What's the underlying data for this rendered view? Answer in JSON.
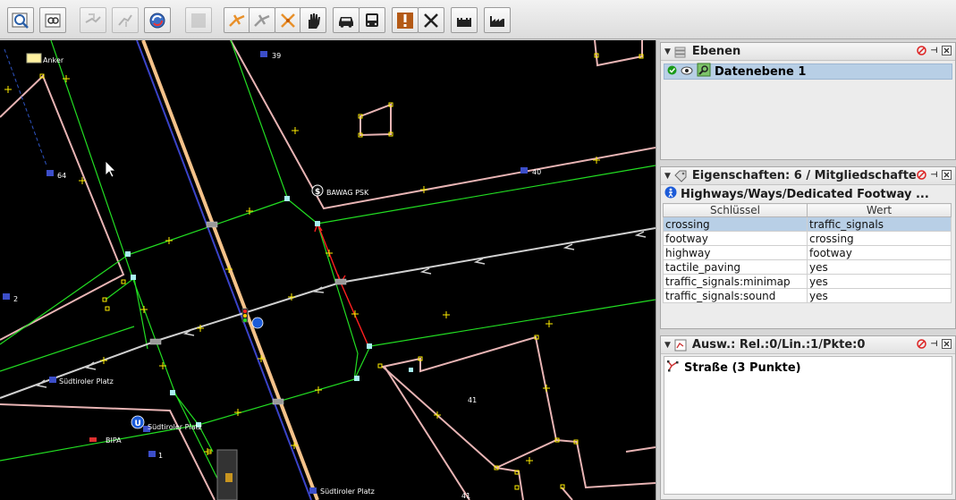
{
  "toolbar": {
    "buttons": [
      {
        "icon": "zoom-to-data-icon",
        "enabled": true
      },
      {
        "icon": "zoom-to-selection-icon",
        "enabled": true
      },
      {
        "icon": "download-icon",
        "enabled": false
      },
      {
        "icon": "upload-icon",
        "enabled": false
      },
      {
        "icon": "refresh-icon",
        "enabled": true
      },
      {
        "icon": "empty-icon",
        "enabled": false
      },
      {
        "icon": "highway-tool-icon",
        "enabled": true
      },
      {
        "icon": "highway-tool-disabled-icon",
        "enabled": false
      },
      {
        "icon": "cross-tool-icon",
        "enabled": true
      },
      {
        "icon": "hand-icon",
        "enabled": true
      },
      {
        "icon": "car-icon",
        "enabled": true
      },
      {
        "icon": "bus-icon",
        "enabled": true
      },
      {
        "icon": "warning-icon",
        "enabled": true
      },
      {
        "icon": "restaurant-icon",
        "enabled": true
      },
      {
        "icon": "castle-icon",
        "enabled": true
      },
      {
        "icon": "industry-icon",
        "enabled": true
      }
    ]
  },
  "map": {
    "labels": {
      "anker": "Anker",
      "bawag": "BAWAG PSK",
      "suedtiroler_1": "Südtiroler Platz",
      "suedtiroler_2": "Südtiroler Platz",
      "suedtiroler_3": "Südtiroler Platz",
      "bipa": "BIPA",
      "n39": "39",
      "n40": "40",
      "n64": "64",
      "n2": "2",
      "n1": "1",
      "n41a": "41",
      "n41b": "41"
    }
  },
  "layers_panel": {
    "title": "Ebenen",
    "layers": [
      {
        "name": "Datenebene 1"
      }
    ]
  },
  "properties_panel": {
    "title": "Eigenschaften: 6 / Mitgliedschafte",
    "preset": "Highways/Ways/Dedicated Footway ...",
    "col_key": "Schlüssel",
    "col_value": "Wert",
    "rows": [
      {
        "key": "crossing",
        "value": "traffic_signals"
      },
      {
        "key": "footway",
        "value": "crossing"
      },
      {
        "key": "highway",
        "value": "footway"
      },
      {
        "key": "tactile_paving",
        "value": "yes"
      },
      {
        "key": "traffic_signals:minimap",
        "value": "yes"
      },
      {
        "key": "traffic_signals:sound",
        "value": "yes"
      }
    ]
  },
  "selection_panel": {
    "title": "Ausw.: Rel.:0/Lin.:1/Pkte:0",
    "items": [
      {
        "label": "Straße (3 Punkte)"
      }
    ]
  },
  "colors": {
    "map_bg": "#000000",
    "building": "#e8b4b4",
    "footway": "#22dd22",
    "primary_road": "#f5c28a",
    "selected_way": "#ff2020",
    "node": "#ffff00",
    "panel_selection": "#b8cfe6"
  }
}
